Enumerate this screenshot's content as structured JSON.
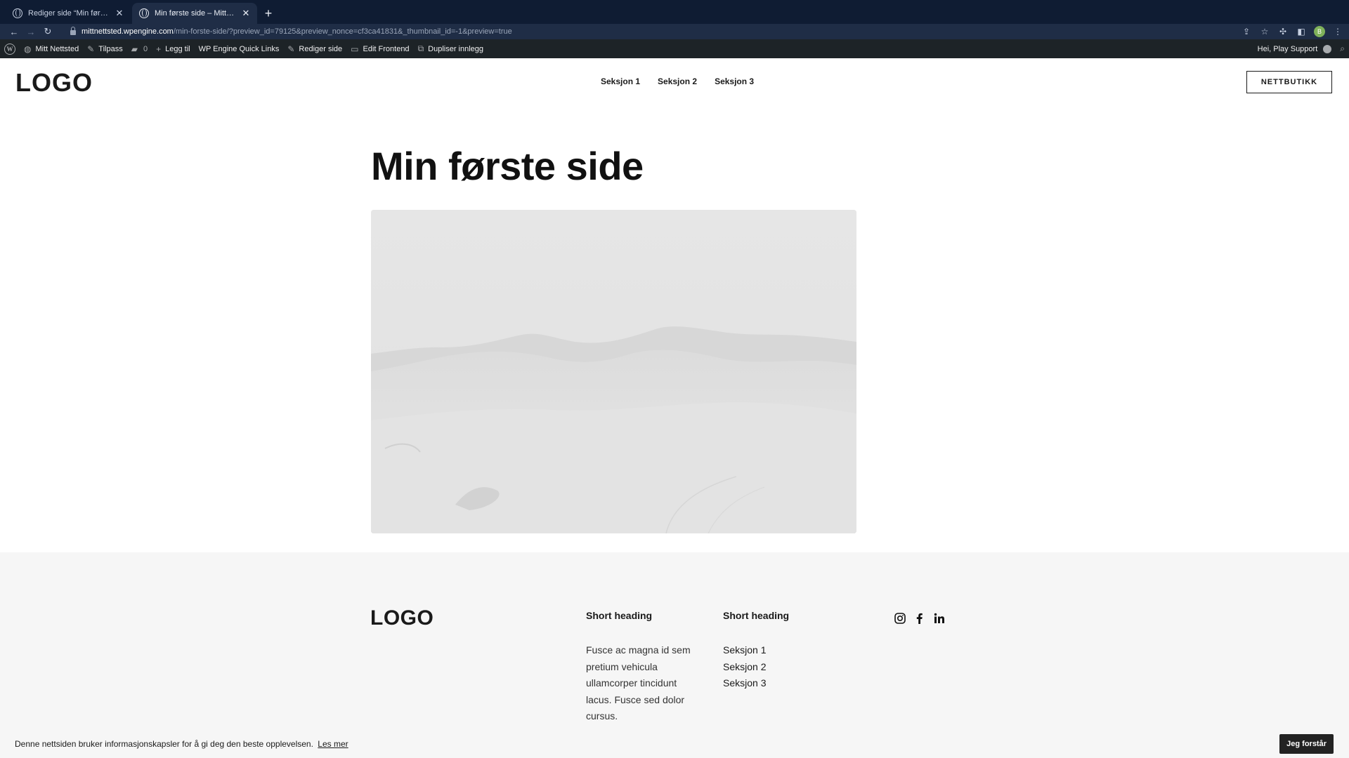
{
  "browser": {
    "tabs": [
      {
        "title": "Rediger side “Min første side”",
        "active": false
      },
      {
        "title": "Min første side – Mitt Nettsted",
        "active": true
      }
    ],
    "url_host": "mittnettsted.wpengine.com",
    "url_path": "/min-forste-side/?preview_id=79125&preview_nonce=cf3ca41831&_thumbnail_id=-1&preview=true",
    "profile_initial": "B"
  },
  "adminbar": {
    "site_name": "Mitt Nettsted",
    "customize": "Tilpass",
    "comments_count": "0",
    "new": "Legg til",
    "quick_links": "WP Engine Quick Links",
    "edit_page": "Rediger side",
    "edit_frontend": "Edit Frontend",
    "duplicate": "Dupliser innlegg",
    "greeting": "Hei, Play Support"
  },
  "header": {
    "logo": "LOGO",
    "nav": [
      "Seksjon 1",
      "Seksjon 2",
      "Seksjon 3"
    ],
    "shop_button": "NETTBUTIKK"
  },
  "main": {
    "title": "Min første side"
  },
  "footer": {
    "logo": "LOGO",
    "col1": {
      "heading": "Short heading",
      "text": "Fusce ac magna id sem pretium vehicula ullamcorper tincidunt lacus. Fusce sed dolor cursus."
    },
    "col2": {
      "heading": "Short heading",
      "links": [
        "Seksjon 1",
        "Seksjon 2",
        "Seksjon 3"
      ]
    },
    "social": [
      "instagram-icon",
      "facebook-icon",
      "linkedin-icon"
    ]
  },
  "cookie": {
    "text": "Denne nettsiden bruker informasjonskapsler for å gi deg den beste opplevelsen.",
    "link": "Les mer",
    "button": "Jeg forstår"
  }
}
